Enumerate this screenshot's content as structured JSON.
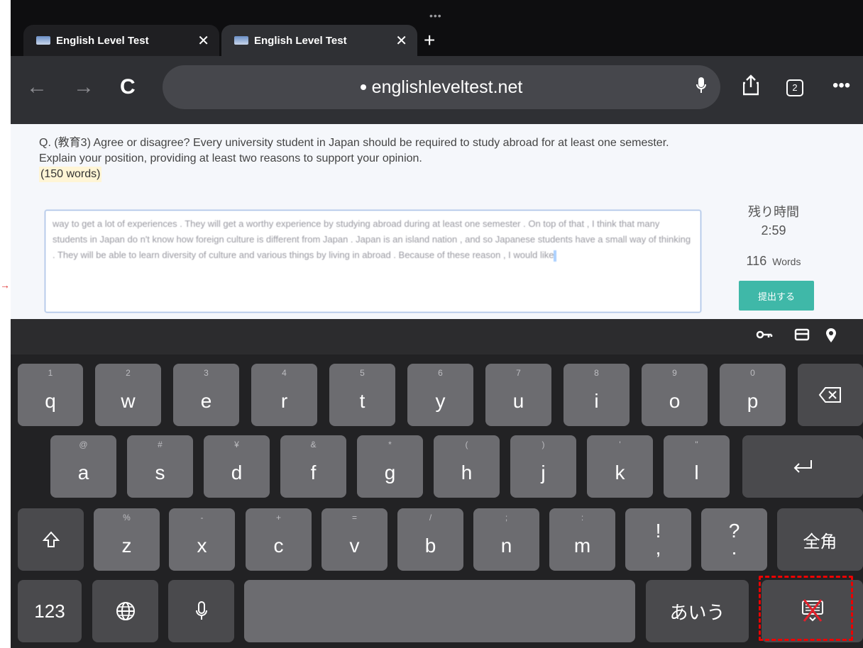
{
  "browser": {
    "grip": "•••",
    "tabs": [
      {
        "title": "English Level Test",
        "close": "✕"
      },
      {
        "title": "English Level Test",
        "close": "✕"
      }
    ],
    "new_tab": "+",
    "url": "englishleveltest.net",
    "tab_count": "2",
    "more": "•••"
  },
  "page": {
    "question": "Q. (教育3) Agree or disagree? Every university student in Japan should be required to study abroad for at least one semester. Explain your position, providing at least two reasons to support your opinion.",
    "word_requirement": "(150 words)",
    "answer_text": "way to get a lot of experiences . They will get a worthy experience by studying abroad during at least one semester . On top of that , I think that many students in Japan do n't know how foreign culture is different from Japan . Japan is an island nation , and so Japanese students have a small way of thinking . They will be able to learn diversity of culture and various things by living in abroad . Because of these reason , I would like",
    "remaining_label": "残り時間",
    "remaining_time": "2:59",
    "word_count": "116",
    "words_label": "Words",
    "submit_label": "提出する"
  },
  "keyboard": {
    "row1": [
      {
        "sub": "1",
        "main": "q"
      },
      {
        "sub": "2",
        "main": "w"
      },
      {
        "sub": "3",
        "main": "e"
      },
      {
        "sub": "4",
        "main": "r"
      },
      {
        "sub": "5",
        "main": "t"
      },
      {
        "sub": "6",
        "main": "y"
      },
      {
        "sub": "7",
        "main": "u"
      },
      {
        "sub": "8",
        "main": "i"
      },
      {
        "sub": "9",
        "main": "o"
      },
      {
        "sub": "0",
        "main": "p"
      }
    ],
    "row2": [
      {
        "sub": "@",
        "main": "a"
      },
      {
        "sub": "#",
        "main": "s"
      },
      {
        "sub": "¥",
        "main": "d"
      },
      {
        "sub": "&",
        "main": "f"
      },
      {
        "sub": "*",
        "main": "g"
      },
      {
        "sub": "(",
        "main": "h"
      },
      {
        "sub": ")",
        "main": "j"
      },
      {
        "sub": "'",
        "main": "k"
      },
      {
        "sub": "\"",
        "main": "l"
      }
    ],
    "row3": [
      {
        "sub": "%",
        "main": "z"
      },
      {
        "sub": "-",
        "main": "x"
      },
      {
        "sub": "+",
        "main": "c"
      },
      {
        "sub": "=",
        "main": "v"
      },
      {
        "sub": "/",
        "main": "b"
      },
      {
        "sub": ";",
        "main": "n"
      },
      {
        "sub": ":",
        "main": "m"
      },
      {
        "sub": "!",
        "main": ","
      },
      {
        "sub": "?",
        "main": "."
      }
    ],
    "numbers_label": "123",
    "kana_label": "あいう",
    "zenkaku_label": "全角"
  }
}
